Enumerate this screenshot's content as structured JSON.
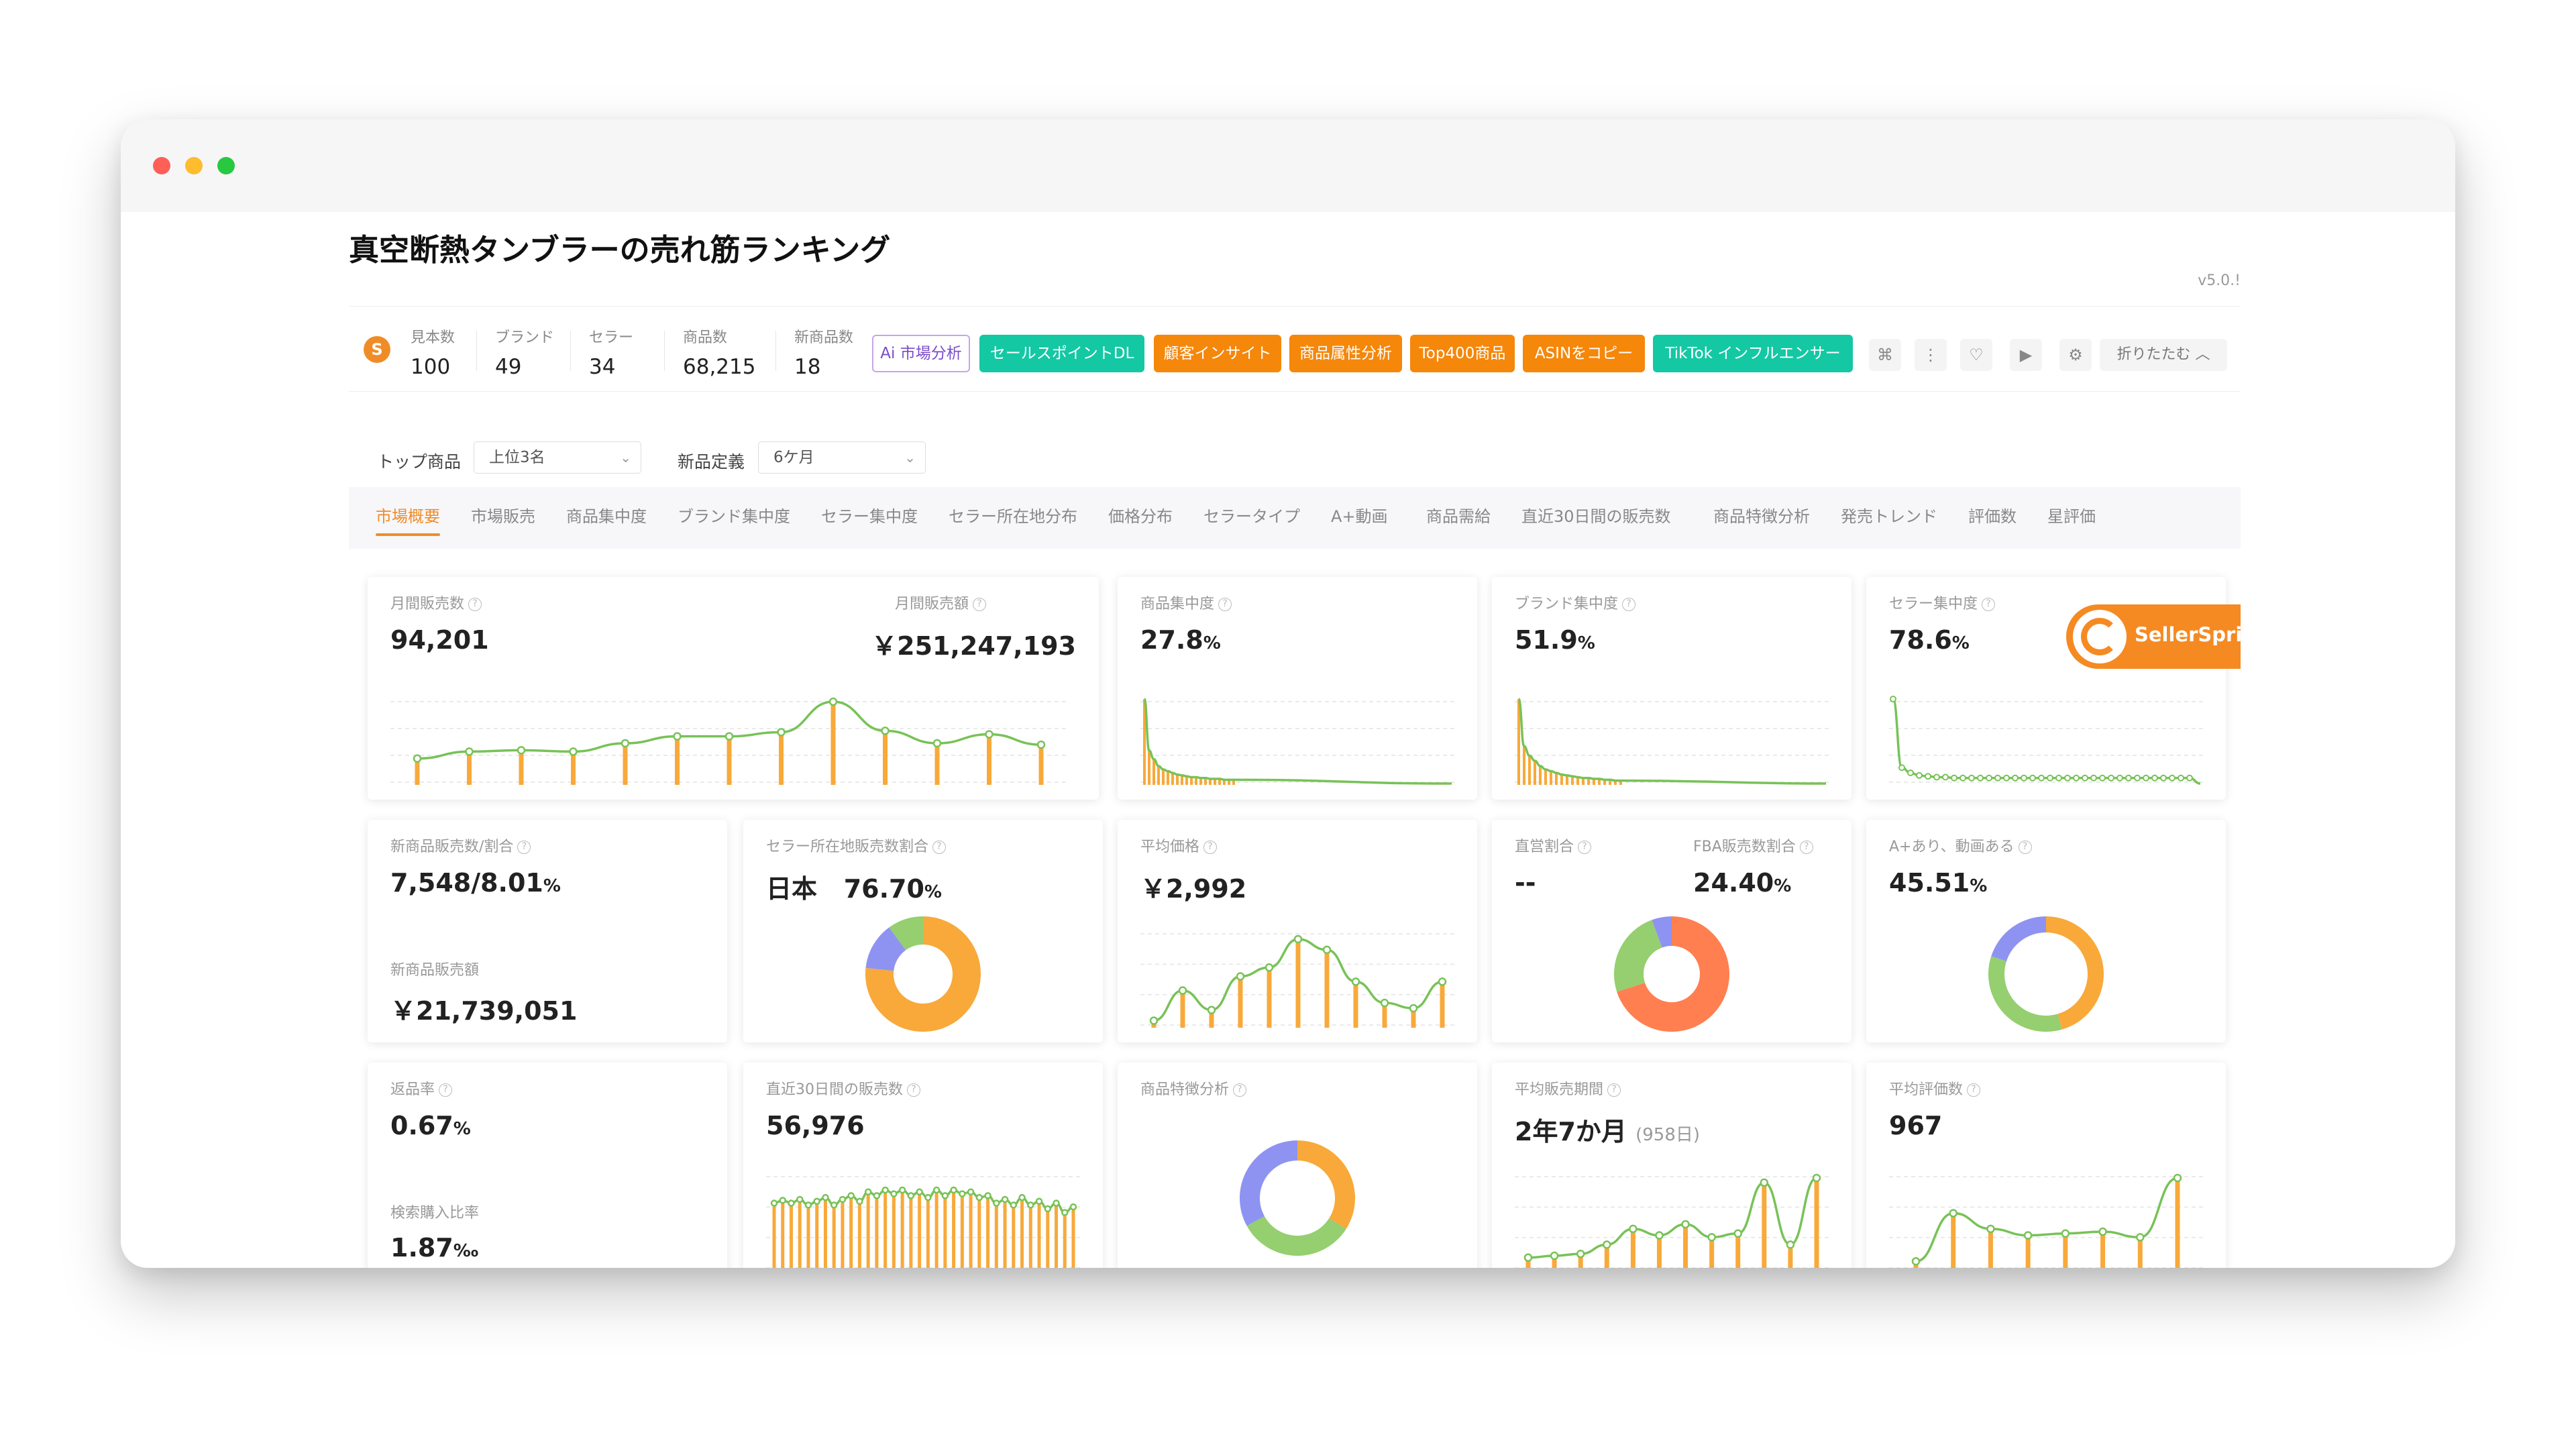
{
  "window": {
    "controls": [
      "close",
      "minimize",
      "maximize"
    ],
    "colors": {
      "close": "#fe5f57",
      "minimize": "#febc2e",
      "maximize": "#28c840"
    }
  },
  "page": {
    "title": "真空断熱タンブラーの売れ筋ランキング",
    "version": "v5.0.!"
  },
  "header": {
    "logo_glyph": "S",
    "stats": [
      {
        "label": "見本数",
        "value": "100"
      },
      {
        "label": "ブランド",
        "value": "49"
      },
      {
        "label": "セラー",
        "value": "34"
      },
      {
        "label": "商品数",
        "value": "68,215"
      },
      {
        "label": "新商品数",
        "value": "18"
      }
    ],
    "buttons": [
      {
        "label": "Ai 市場分析",
        "style": "ai"
      },
      {
        "label": "セールスポイントDL",
        "style": "green"
      },
      {
        "label": "顧客インサイト",
        "style": "orange"
      },
      {
        "label": "商品属性分析",
        "style": "orange"
      },
      {
        "label": "Top400商品",
        "style": "orange"
      },
      {
        "label": "ASINをコピー",
        "style": "orange"
      },
      {
        "label": "TikTok インフルエンサー",
        "style": "green"
      }
    ],
    "icon_glyphs": [
      "⌘",
      "⋮",
      "♡",
      "▶",
      "⚙"
    ],
    "fold_label": "折りたたむ ︿"
  },
  "filters": [
    {
      "label": "トップ商品",
      "value": "上位3名"
    },
    {
      "label": "新品定義",
      "value": "6ケ月"
    }
  ],
  "tabs": [
    "市場概要",
    "市場販売",
    "商品集中度",
    "ブランド集中度",
    "セラー集中度",
    "セラー所在地分布",
    "価格分布",
    "セラータイプ",
    "A+動画",
    "商品需給",
    "直近30日間の販売数",
    "商品特徴分析",
    "発売トレンド",
    "評価数",
    "星評価"
  ],
  "badge": {
    "text": "SellerSprite"
  },
  "cards": {
    "monthly": {
      "label1": "月間販売数",
      "value1": "94,201",
      "label2": "月間販売額",
      "value2": "￥251,247,193"
    },
    "product_conc": {
      "label": "商品集中度",
      "value": "27.8",
      "unit": "%"
    },
    "brand_conc": {
      "label": "ブランド集中度",
      "value": "51.9",
      "unit": "%"
    },
    "seller_conc": {
      "label": "セラー集中度",
      "value": "78.6",
      "unit": "%"
    },
    "new_sales": {
      "label": "新商品販売数/割合",
      "value": "7,548/8.01",
      "unit": "%",
      "label2": "新商品販売額",
      "value2": "￥21,739,051"
    },
    "seller_loc": {
      "label": "セラー所在地販売数割合",
      "value": "日本   76.70",
      "unit": "%"
    },
    "avg_price": {
      "label": "平均価格",
      "value": "￥2,992"
    },
    "direct": {
      "label1": "直営割合",
      "value1": "--",
      "label2": "FBA販売数割合",
      "value2": "24.40",
      "unit": "%"
    },
    "aplus": {
      "label": "A+あり、動画ある",
      "value": "45.51",
      "unit": "%"
    },
    "returns": {
      "label": "返品率",
      "value": "0.67",
      "unit": "%",
      "label2": "検索購入比率",
      "value2": "1.87",
      "unit2": "‰"
    },
    "sales30": {
      "label": "直近30日間の販売数",
      "value": "56,976"
    },
    "features": {
      "label": "商品特徴分析"
    },
    "avg_period": {
      "label": "平均販売期間",
      "value": "2年7か月",
      "sub": "(958日)"
    },
    "avg_rating": {
      "label": "平均評価数",
      "value": "967"
    }
  },
  "chart_data": [
    {
      "type": "bar",
      "name": "monthly-sales",
      "values": [
        38,
        48,
        50,
        48,
        60,
        70,
        70,
        76,
        120,
        78,
        60,
        73,
        58
      ]
    },
    {
      "type": "bar",
      "name": "product-concentration",
      "values": [
        100,
        40,
        30,
        22,
        18,
        16,
        14,
        12,
        11,
        10,
        9,
        9,
        8,
        8,
        7,
        7,
        7,
        6,
        6,
        6
      ]
    },
    {
      "type": "bar",
      "name": "brand-concentration",
      "values": [
        100,
        45,
        34,
        28,
        22,
        18,
        16,
        14,
        12,
        11,
        10,
        9,
        8,
        8,
        7,
        7,
        6,
        6,
        5,
        5
      ]
    },
    {
      "type": "line",
      "name": "seller-concentration",
      "values": [
        100,
        20,
        14,
        11,
        10,
        9,
        9,
        8,
        8,
        8,
        8,
        8,
        8,
        8,
        8,
        8,
        8,
        8,
        8,
        8,
        8,
        8,
        8,
        8,
        8,
        8,
        8,
        8,
        8,
        8,
        8,
        8,
        8,
        8,
        8
      ]
    },
    {
      "type": "pie",
      "name": "seller-location",
      "values": [
        76.7,
        13.3,
        10.0
      ],
      "colors": [
        "#f8a93a",
        "#8e93f2",
        "#95cf6f"
      ]
    },
    {
      "type": "bar",
      "name": "avg-price",
      "values": [
        8,
        42,
        20,
        58,
        68,
        100,
        88,
        52,
        28,
        22,
        52
      ]
    },
    {
      "type": "pie",
      "name": "direct-fba",
      "values": [
        70,
        24.4,
        5.6
      ],
      "colors": [
        "#ff7f50",
        "#95cf6f",
        "#8e93f2"
      ]
    },
    {
      "type": "pie",
      "name": "aplus-video",
      "values": [
        45.51,
        34.49,
        20.0
      ],
      "colors": [
        "#f8a93a",
        "#95cf6f",
        "#8e93f2"
      ]
    },
    {
      "type": "bar",
      "name": "sales-30days",
      "values": [
        72,
        75,
        72,
        76,
        70,
        74,
        78,
        70,
        76,
        80,
        74,
        84,
        80,
        86,
        82,
        86,
        80,
        84,
        78,
        86,
        80,
        86,
        82,
        84,
        78,
        80,
        72,
        76,
        70,
        78,
        70,
        74,
        66,
        72,
        62,
        68
      ]
    },
    {
      "type": "pie",
      "name": "product-features",
      "values": [
        34,
        33,
        33
      ],
      "colors": [
        "#f8a93a",
        "#95cf6f",
        "#8e93f2"
      ]
    },
    {
      "type": "bar",
      "name": "avg-sales-period",
      "values": [
        14,
        16,
        18,
        28,
        45,
        38,
        50,
        36,
        40,
        95,
        28,
        100
      ]
    },
    {
      "type": "bar",
      "name": "avg-rating",
      "values": [
        10,
        62,
        45,
        38,
        40,
        42,
        36,
        100
      ]
    }
  ]
}
